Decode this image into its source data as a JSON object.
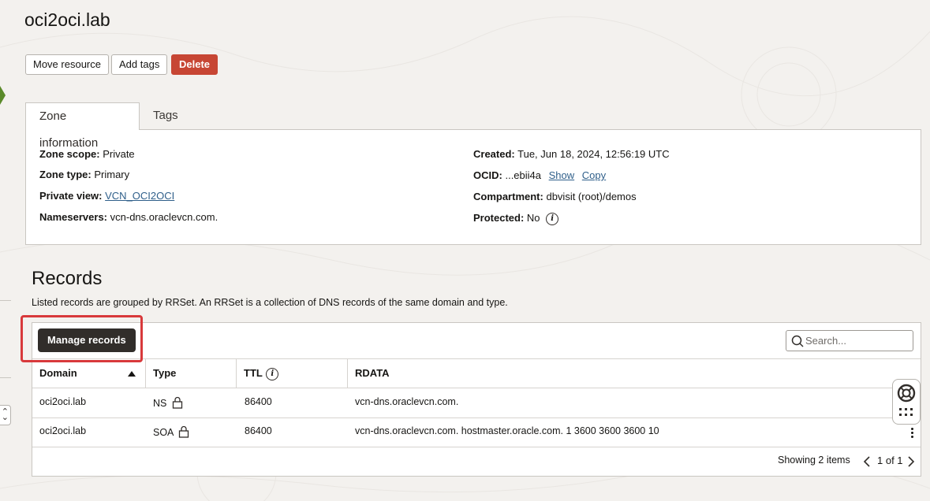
{
  "page": {
    "title": "oci2oci.lab"
  },
  "actions": {
    "move": "Move resource",
    "add_tags": "Add tags",
    "delete": "Delete"
  },
  "tabs": [
    {
      "label": "Zone information",
      "active": true
    },
    {
      "label": "Tags",
      "active": false
    }
  ],
  "zone_info": {
    "left": [
      {
        "label": "Zone scope:",
        "value": "Private"
      },
      {
        "label": "Zone type:",
        "value": "Primary"
      },
      {
        "label": "Private view:",
        "value": "VCN_OCI2OCI"
      },
      {
        "label": "Nameservers:",
        "value": "vcn-dns.oraclevcn.com."
      }
    ],
    "created": {
      "label": "Created:",
      "value": "Tue, Jun 18, 2024, 12:56:19 UTC"
    },
    "ocid": {
      "label": "OCID:",
      "value": "...ebii4a",
      "show": "Show",
      "copy": "Copy"
    },
    "compartment": {
      "label": "Compartment:",
      "value": "dbvisit (root)/demos"
    },
    "protected": {
      "label": "Protected:",
      "value": "No"
    }
  },
  "records": {
    "title": "Records",
    "description": "Listed records are grouped by RRSet. An RRSet is a collection of DNS records of the same domain and type.",
    "manage_button": "Manage records",
    "search_placeholder": "Search...",
    "columns": [
      "Domain",
      "Type",
      "TTL",
      "RDATA"
    ],
    "rows": [
      {
        "domain": "oci2oci.lab",
        "type": "NS",
        "ttl": "86400",
        "rdata": "vcn-dns.oraclevcn.com."
      },
      {
        "domain": "oci2oci.lab",
        "type": "SOA",
        "ttl": "86400",
        "rdata": "vcn-dns.oraclevcn.com. hostmaster.oracle.com. 1 3600 3600 3600 10"
      }
    ],
    "footer": {
      "showing": "Showing 2 items",
      "page": "1 of 1"
    }
  },
  "colors": {
    "danger": "#c74634",
    "dark_button": "#312d2a",
    "highlight": "#d8393b",
    "link": "#2f5f8a"
  }
}
